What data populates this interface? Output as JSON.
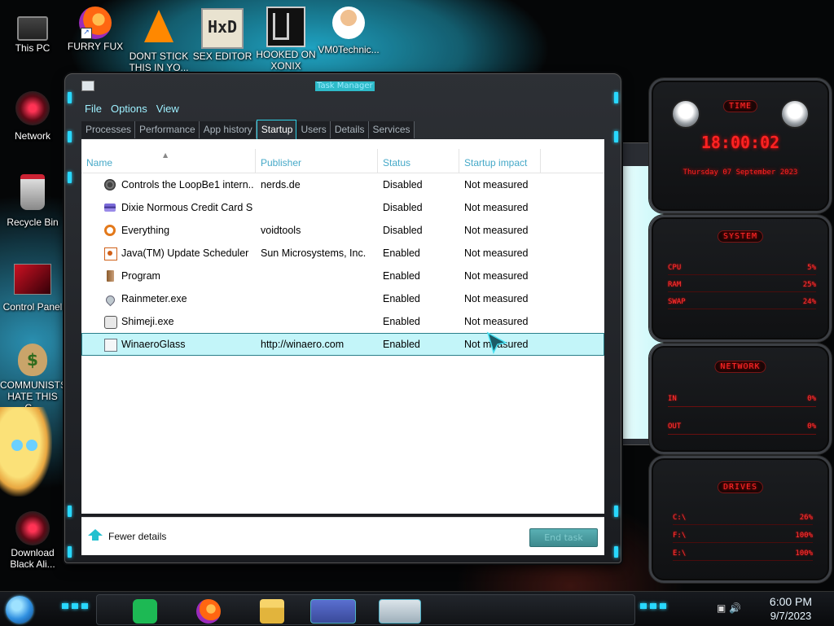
{
  "desktop": {
    "icons": [
      {
        "label": "This PC",
        "icon": "computer-icon"
      },
      {
        "label": "FURRY FUX",
        "icon": "firefox-icon"
      },
      {
        "label": "DONT STICK THIS IN YO...",
        "icon": "vlc-icon"
      },
      {
        "label": "SEX EDITOR",
        "icon": "hxd-icon"
      },
      {
        "label": "HOOKED ON XONIX",
        "icon": "xonix-icon"
      },
      {
        "label": "VM0Technic...",
        "icon": "doctor-icon"
      },
      {
        "label": "Network",
        "icon": "network-icon"
      },
      {
        "label": "Recycle Bin",
        "icon": "recycle-bin-icon"
      },
      {
        "label": "Control Panel",
        "icon": "control-panel-icon"
      },
      {
        "label": "COMMUNISTS HATE THIS G...",
        "icon": "money-bag-icon"
      },
      {
        "label": "Download Black Ali...",
        "icon": "alien-icon"
      }
    ]
  },
  "window": {
    "title": "Task Manager",
    "menu": [
      "File",
      "Options",
      "View"
    ],
    "tabs": [
      "Processes",
      "Performance",
      "App history",
      "Startup",
      "Users",
      "Details",
      "Services"
    ],
    "active_tab": "Startup",
    "columns": [
      "Name",
      "Publisher",
      "Status",
      "Startup impact"
    ],
    "rows": [
      {
        "name": "Controls the LoopBe1 intern...",
        "publisher": "nerds.de",
        "status": "Disabled",
        "impact": "Not measured",
        "icon": "loopbe-icon"
      },
      {
        "name": "Dixie Normous Credit Card S...",
        "publisher": "",
        "status": "Disabled",
        "impact": "Not measured",
        "icon": "credit-card-icon"
      },
      {
        "name": "Everything",
        "publisher": "voidtools",
        "status": "Disabled",
        "impact": "Not measured",
        "icon": "search-icon"
      },
      {
        "name": "Java(TM) Update Scheduler",
        "publisher": "Sun Microsystems, Inc.",
        "status": "Enabled",
        "impact": "Not measured",
        "icon": "java-icon"
      },
      {
        "name": "Program",
        "publisher": "",
        "status": "Enabled",
        "impact": "Not measured",
        "icon": "program-icon"
      },
      {
        "name": "Rainmeter.exe",
        "publisher": "",
        "status": "Enabled",
        "impact": "Not measured",
        "icon": "rainmeter-icon"
      },
      {
        "name": "Shimeji.exe",
        "publisher": "",
        "status": "Enabled",
        "impact": "Not measured",
        "icon": "shimeji-icon"
      },
      {
        "name": "WinaeroGlass",
        "publisher": "http://winaero.com",
        "status": "Enabled",
        "impact": "Not measured",
        "icon": "winaero-icon",
        "selected": true
      }
    ],
    "fewer_details": "Fewer details",
    "end_task": "End task"
  },
  "widgets": {
    "time": {
      "title": "TIME",
      "clock": "18:00:02",
      "date": "Thursday 07 September 2023"
    },
    "system": {
      "title": "SYSTEM",
      "lines": [
        {
          "label": "CPU",
          "value": "5%"
        },
        {
          "label": "RAM",
          "value": "25%"
        },
        {
          "label": "SWAP",
          "value": "24%"
        }
      ]
    },
    "network": {
      "title": "NETWORK",
      "lines": [
        {
          "label": "IN",
          "value": "0%"
        },
        {
          "label": "OUT",
          "value": "0%"
        }
      ]
    },
    "drives": {
      "title": "DRIVES",
      "lines": [
        {
          "label": "C:\\",
          "value": "26%"
        },
        {
          "label": "F:\\",
          "value": "100%"
        },
        {
          "label": "E:\\",
          "value": "100%"
        }
      ]
    }
  },
  "taskbar": {
    "time": "6:00 PM",
    "date": "9/7/2023",
    "apps": [
      "spotify-icon",
      "firefox-icon",
      "file-explorer-icon",
      "credit-card-app-icon",
      "task-manager-icon"
    ]
  },
  "colors": {
    "accent": "#28d8ff",
    "widget_red": "#ff2222",
    "selection": "#c3f5f9"
  }
}
